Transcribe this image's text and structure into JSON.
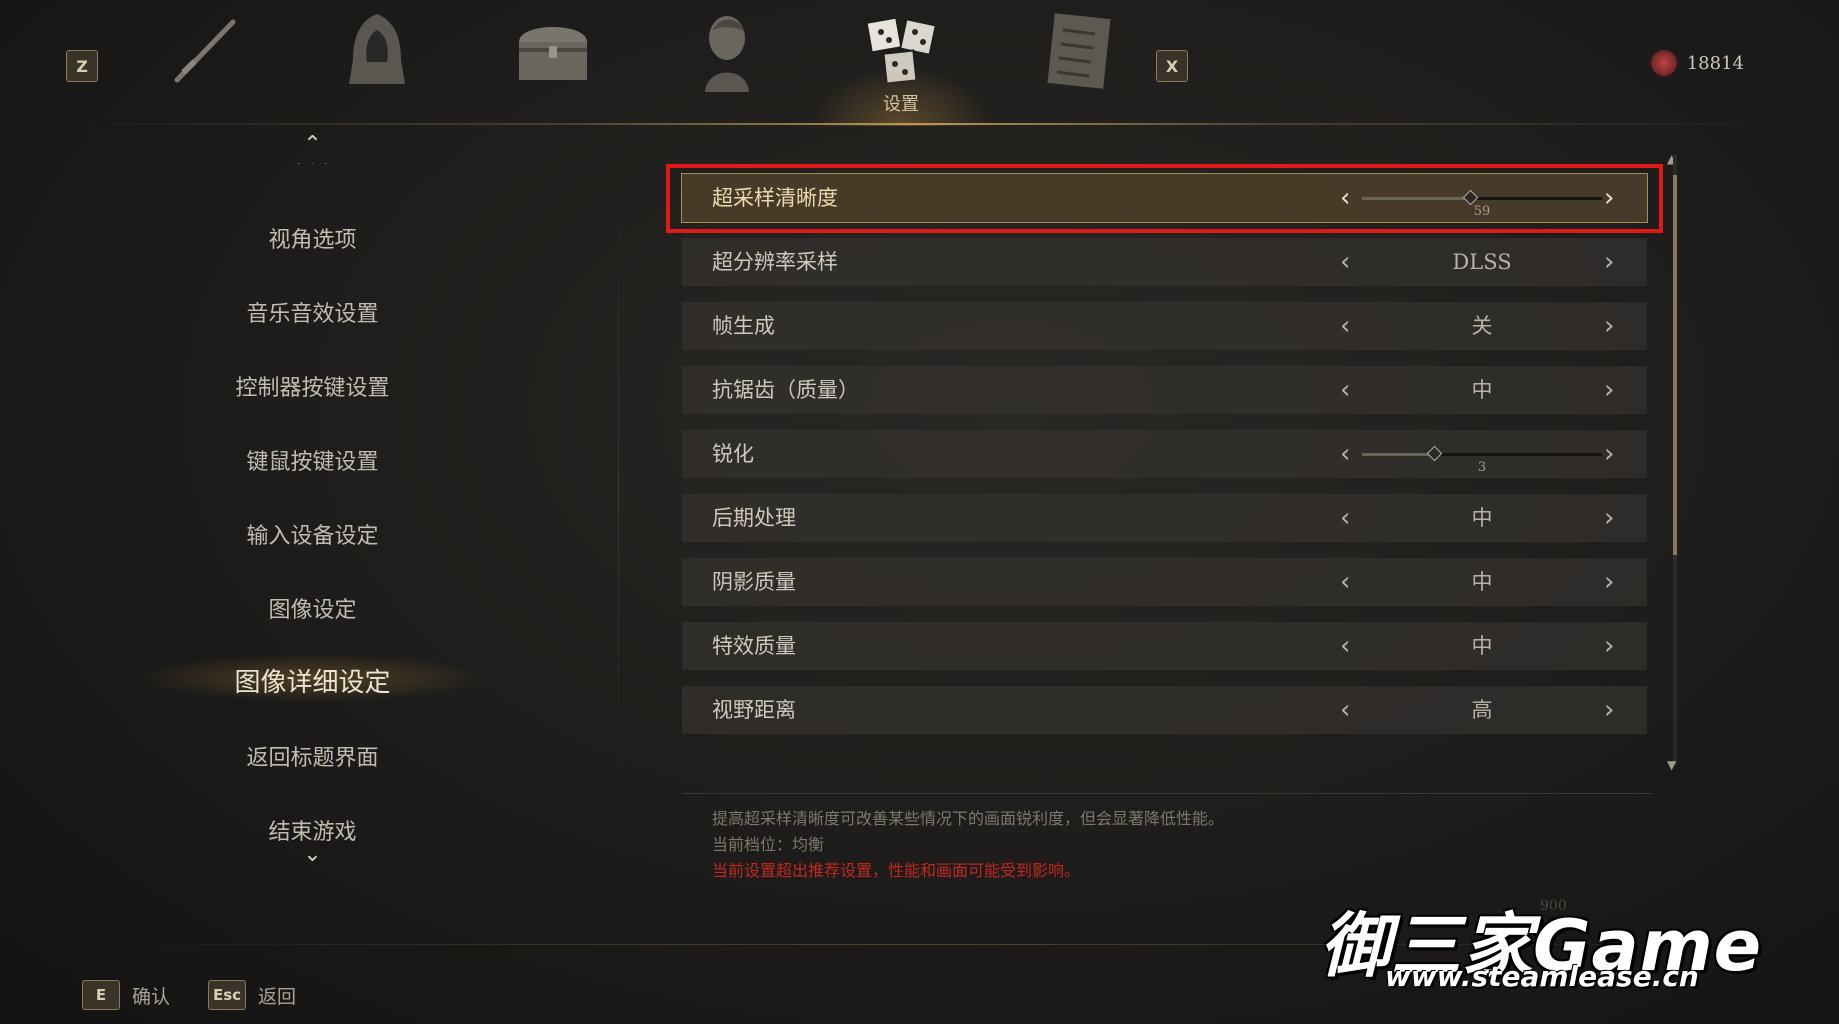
{
  "topnav": {
    "left_key": "Z",
    "right_key": "X",
    "tabs": [
      {
        "icon": "sword-icon"
      },
      {
        "icon": "hood-armor-icon"
      },
      {
        "icon": "chest-icon"
      },
      {
        "icon": "character-portrait-icon"
      },
      {
        "icon": "settings-dice-icon",
        "label": "设置",
        "active": true
      },
      {
        "icon": "scroll-map-icon"
      }
    ],
    "currency": "18814"
  },
  "leftmenu": {
    "items": [
      "视角选项",
      "音乐音效设置",
      "控制器按键设置",
      "键鼠按键设置",
      "输入设备设定",
      "图像设定",
      "图像详细设定",
      "返回标题界面",
      "结束游戏"
    ],
    "active_index": 6
  },
  "settings": [
    {
      "name": "超采样清晰度",
      "type": "slider",
      "value": 59,
      "fraction": 0.45,
      "selected": true
    },
    {
      "name": "超分辨率采样",
      "type": "option",
      "value": "DLSS"
    },
    {
      "name": "帧生成",
      "type": "option",
      "value": "关"
    },
    {
      "name": "抗锯齿（质量）",
      "type": "option",
      "value": "中"
    },
    {
      "name": "锐化",
      "type": "slider",
      "value": 3,
      "fraction": 0.3
    },
    {
      "name": "后期处理",
      "type": "option",
      "value": "中"
    },
    {
      "name": "阴影质量",
      "type": "option",
      "value": "中"
    },
    {
      "name": "特效质量",
      "type": "option",
      "value": "中"
    },
    {
      "name": "视野距离",
      "type": "option",
      "value": "高"
    }
  ],
  "description": {
    "line1": "提高超采样清晰度可改善某些情况下的画面锐利度，但会显著降低性能。",
    "line2": "当前档位：均衡",
    "warning": "当前设置超出推荐设置，性能和画面可能受到影响。"
  },
  "hints": [
    {
      "key": "E",
      "label": "确认"
    },
    {
      "key": "Esc",
      "label": "返回"
    }
  ],
  "watermark": {
    "main": "御三家Game",
    "sub": "www.steamlease.cn",
    "faint": "900"
  },
  "colors": {
    "highlight": "#e01818",
    "warning": "#c2281f",
    "accent": "#a88b58"
  }
}
